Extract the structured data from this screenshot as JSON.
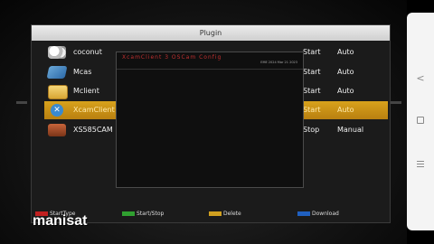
{
  "window": {
    "title": "Plugin"
  },
  "plugins": [
    {
      "name": "coconut",
      "state": "Start",
      "mode": "Auto",
      "icon": "coconut-icon"
    },
    {
      "name": "Mcas",
      "state": "Start",
      "mode": "Auto",
      "icon": "mcas-icon"
    },
    {
      "name": "Mclient",
      "state": "Start",
      "mode": "Auto",
      "icon": "mclient-icon"
    },
    {
      "name": "XcamClient",
      "state": "Start",
      "mode": "Auto",
      "icon": "xcam-icon",
      "selected": true
    },
    {
      "name": "XS585CAM",
      "state": "Stop",
      "mode": "Manual",
      "icon": "xs585cam-icon"
    }
  ],
  "popup": {
    "title": "XcamClient 3 OSCam Config",
    "info": "EME 2024  Mar 21 2023"
  },
  "footer": {
    "red": "StartType",
    "green": "Start/Stop",
    "yellow": "Delete",
    "blue": "Download"
  },
  "watermark": "manisat",
  "colors": {
    "selection": "#d8a21c",
    "red_key": "#c02020",
    "green_key": "#30a030",
    "yellow_key": "#d0a020",
    "blue_key": "#2060c0"
  }
}
